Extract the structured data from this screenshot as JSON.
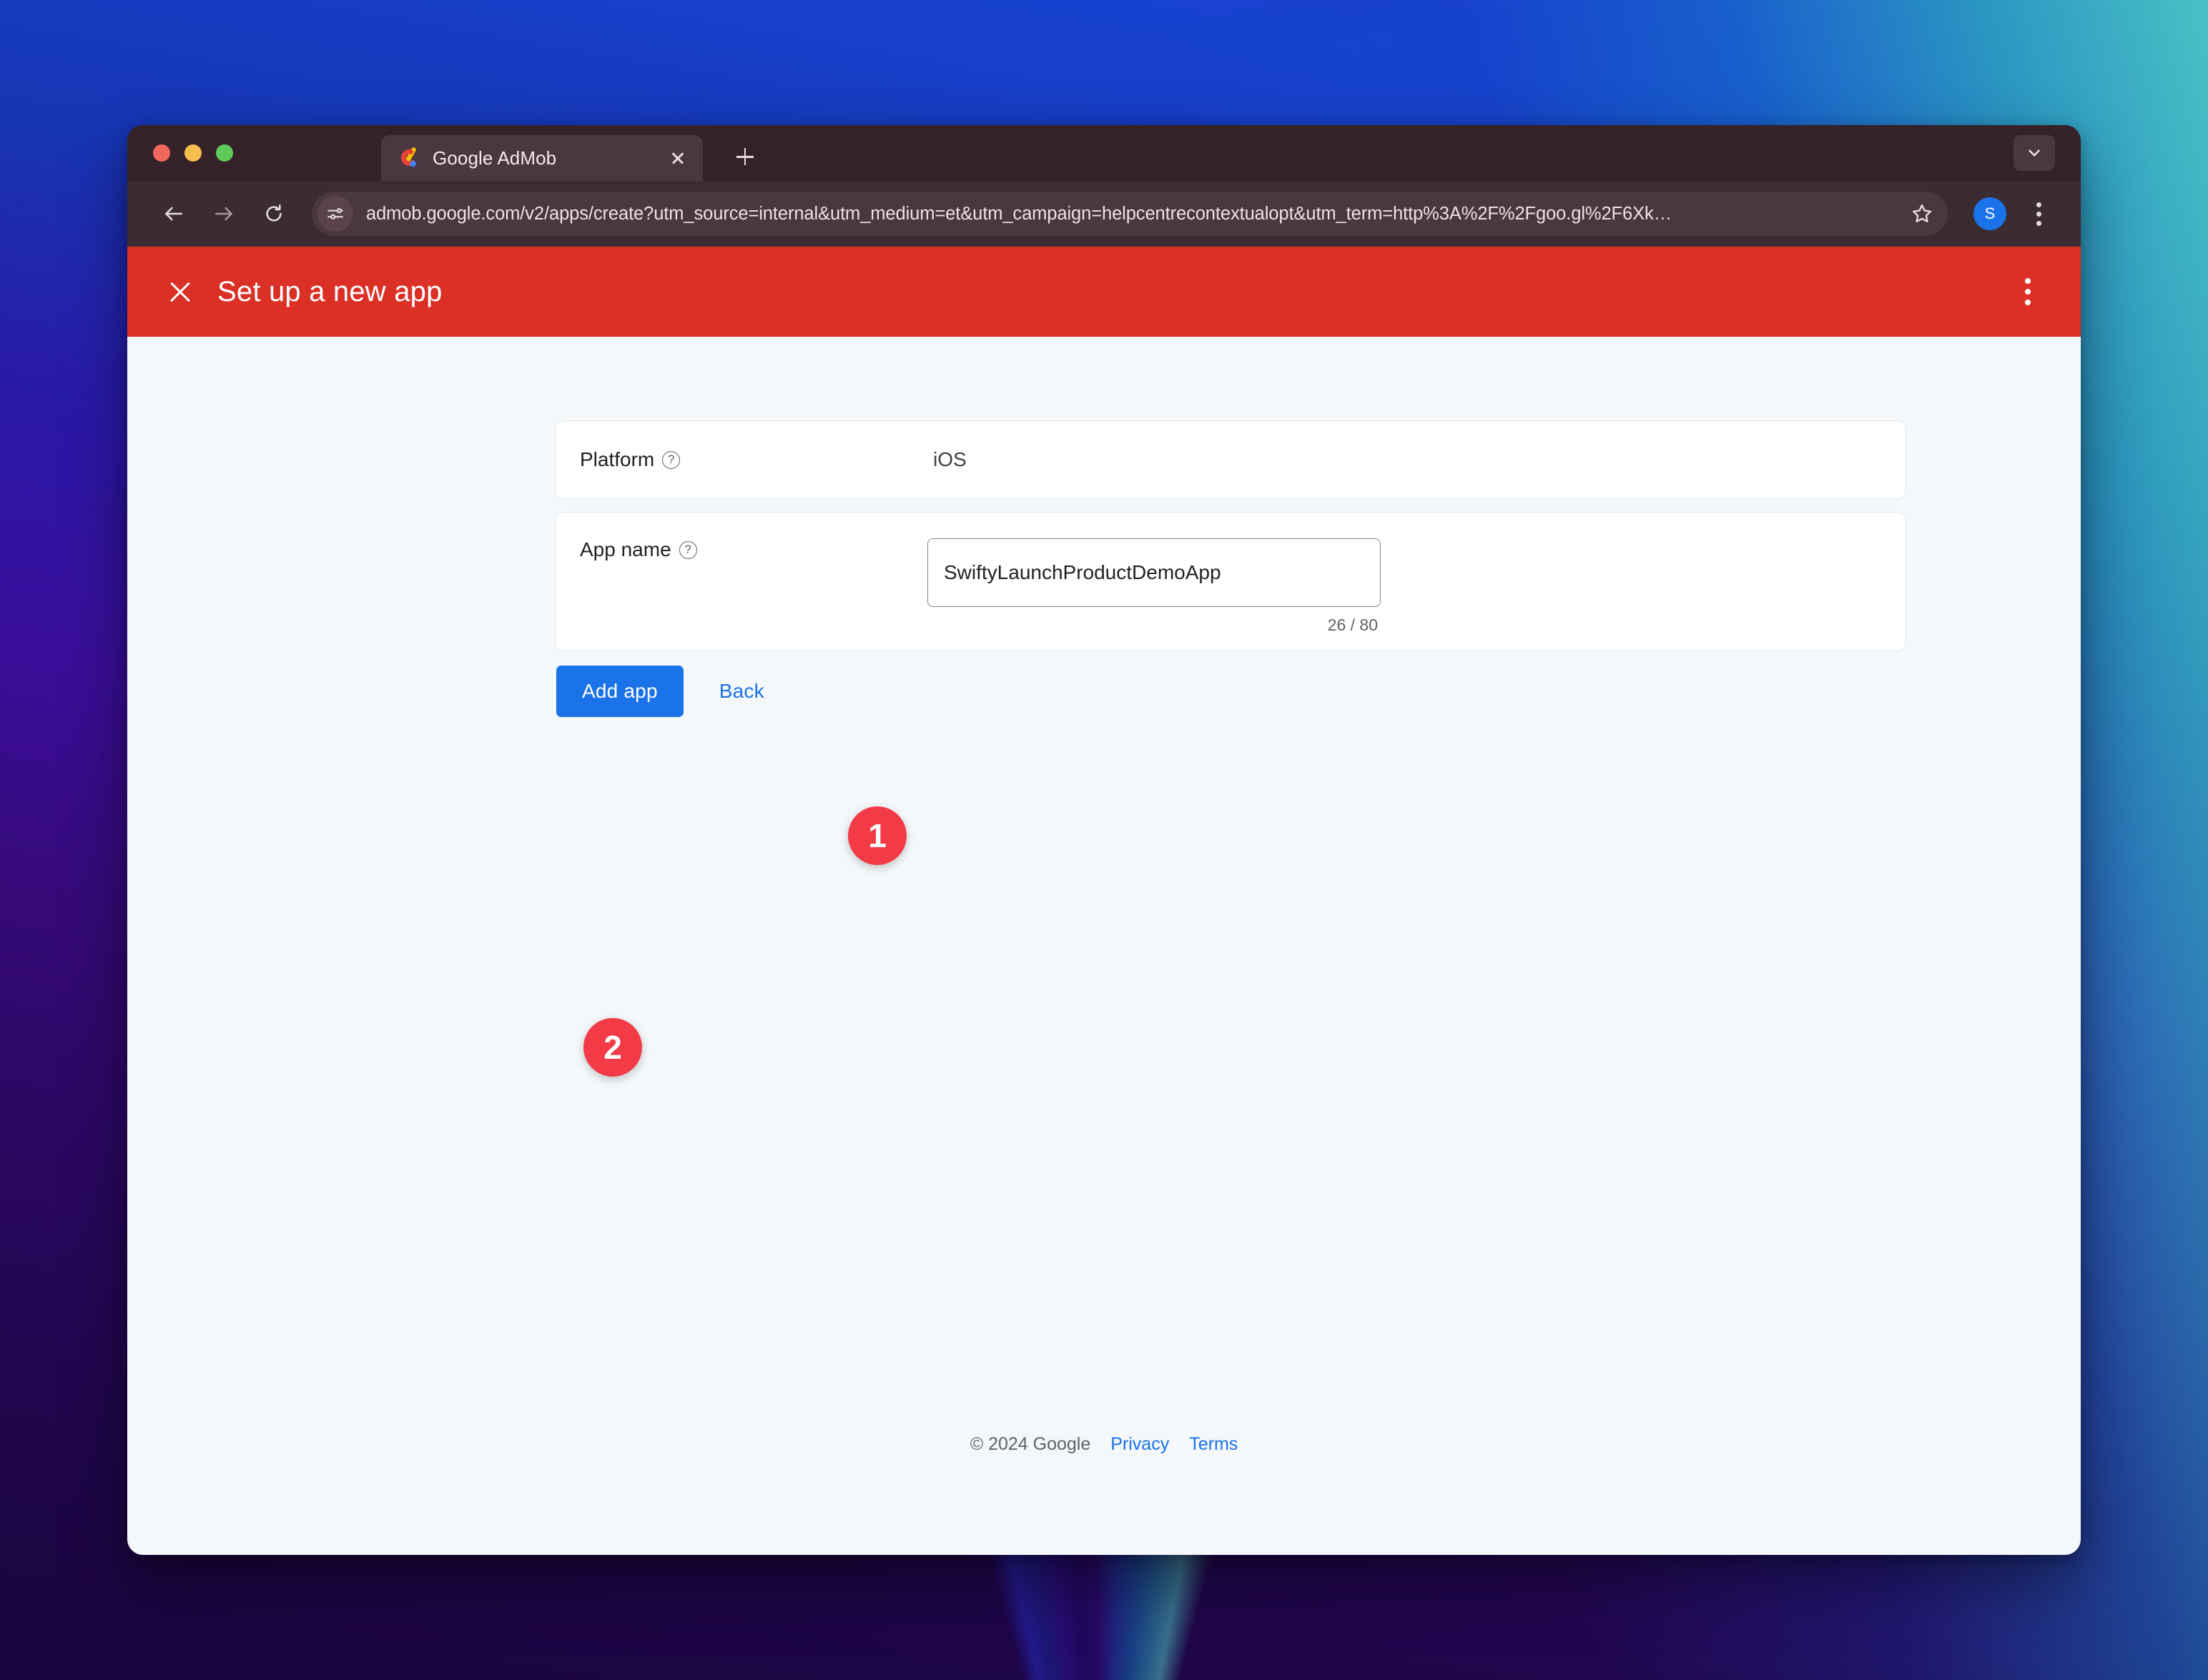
{
  "browser": {
    "traffic_lights": [
      "close",
      "minimize",
      "zoom"
    ],
    "tab": {
      "title": "Google AdMob",
      "favicon": "admob-logo-icon",
      "close_label": "×"
    },
    "new_tab_label": "+",
    "tab_search": "chevron-down-icon",
    "toolbar": {
      "back": "back-arrow-icon",
      "forward": "forward-arrow-icon",
      "reload": "reload-icon",
      "site_settings": "tune-sliders-icon",
      "url": "admob.google.com/v2/apps/create?utm_source=internal&utm_medium=et&utm_campaign=helpcentrecontextualopt&utm_term=http%3A%2F%2Fgoo.gl%2F6Xk…",
      "bookmark": "star-icon",
      "avatar_initial": "S",
      "menu": "kebab-menu-icon"
    }
  },
  "app_header": {
    "close_label": "Close",
    "title": "Set up a new app",
    "menu_label": "More options"
  },
  "form": {
    "platform": {
      "label": "Platform",
      "help": "?",
      "value": "iOS"
    },
    "app_name": {
      "label": "App name",
      "help": "?",
      "value": "SwiftyLaunchProductDemoApp",
      "placeholder": "",
      "counter": "26 / 80",
      "max_length": 80
    }
  },
  "actions": {
    "primary_label": "Add app",
    "secondary_label": "Back"
  },
  "annotations": [
    {
      "id": "1",
      "target": "app-name-input"
    },
    {
      "id": "2",
      "target": "add-app-button"
    }
  ],
  "footer": {
    "copyright": "© 2024 Google",
    "privacy": "Privacy",
    "terms": "Terms"
  },
  "colors": {
    "header_red": "#DA3025",
    "primary_blue": "#1A73E8",
    "badge_red": "#F23B46",
    "page_bg": "#F5F8FA",
    "chrome_bg": "#3B2B33"
  }
}
